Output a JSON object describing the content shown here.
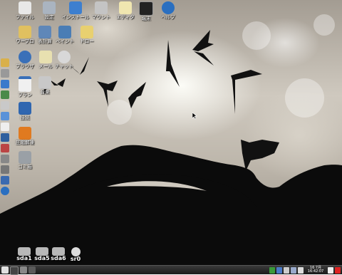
{
  "desktop_icons": [
    {
      "label": "ファイル",
      "icon": "home-folder-icon"
    },
    {
      "label": "設定",
      "icon": "settings-tools-icon"
    },
    {
      "label": "インストール",
      "icon": "install-icon"
    },
    {
      "label": "マウント",
      "icon": "mount-icon"
    },
    {
      "label": "エディタ",
      "icon": "editor-icon"
    },
    {
      "label": "端末",
      "icon": "terminal-icon"
    },
    {
      "label": "ヘルプ",
      "icon": "help-icon"
    },
    {
      "label": "ワープロ",
      "icon": "wordprocessor-icon"
    },
    {
      "label": "表計算",
      "icon": "spreadsheet-icon"
    },
    {
      "label": "ペイント",
      "icon": "paint-icon"
    },
    {
      "label": "ドロー",
      "icon": "draw-icon"
    },
    {
      "label": "ブラウザ",
      "icon": "browser-icon"
    },
    {
      "label": "メール",
      "icon": "mail-icon"
    },
    {
      "label": "チャット",
      "icon": "chat-icon"
    },
    {
      "label": "プラン",
      "icon": "calendar-icon"
    },
    {
      "label": "音楽",
      "icon": "music-icon"
    },
    {
      "label": "接続",
      "icon": "network-icon"
    },
    {
      "label": "圧縮解凍",
      "icon": "archive-icon"
    },
    {
      "label": "ゴミ箱",
      "icon": "trash-icon"
    }
  ],
  "drives": [
    {
      "label": "sda1",
      "icon": "drive-icon"
    },
    {
      "label": "sda5",
      "icon": "drive-icon"
    },
    {
      "label": "sda6",
      "icon": "drive-icon"
    },
    {
      "label": "sr0",
      "icon": "optical-drive-icon"
    }
  ],
  "taskbar": {
    "clock_date": "16 7月",
    "clock_time": "16:42:07"
  },
  "colors": {
    "taskbar": "#222222",
    "help_blue": "#2a6fc0",
    "wallpaper_light": "#e9e4da"
  }
}
